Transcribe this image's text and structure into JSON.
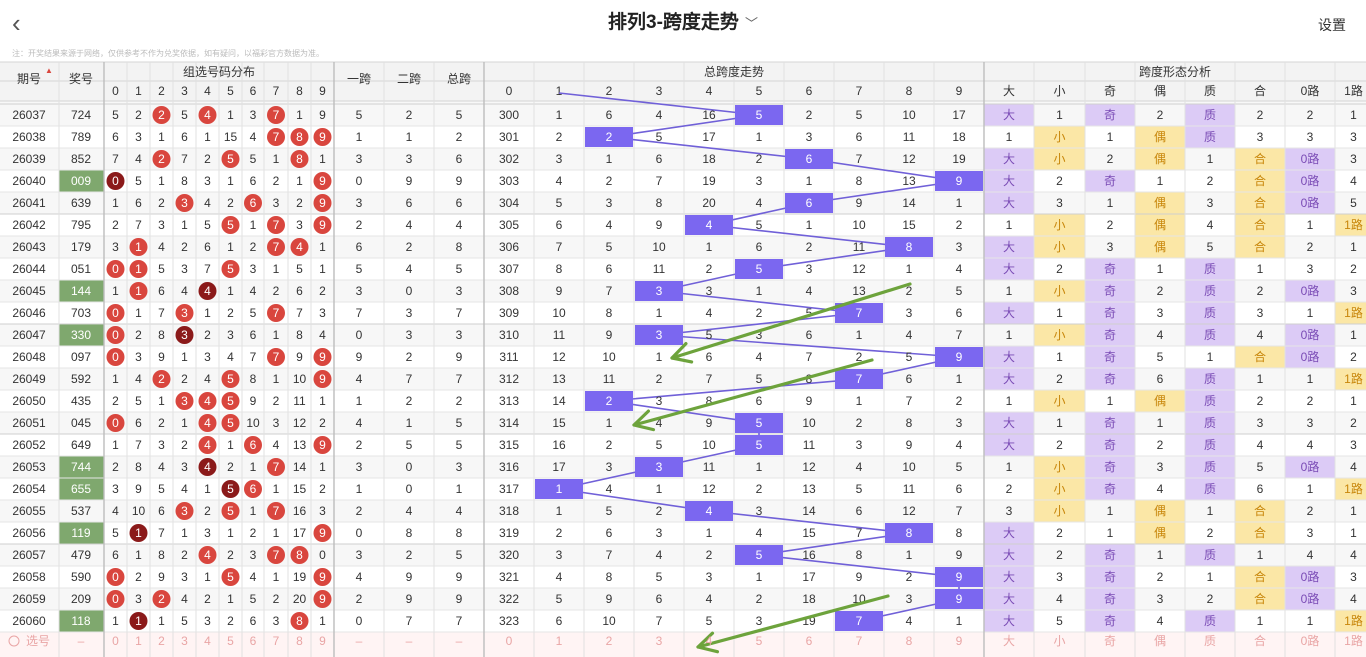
{
  "header": {
    "back_icon": "‹",
    "title": "排列3-跨度走势",
    "dropdown_icon": "chevron-down",
    "settings": "设置"
  },
  "note": "注：开奖结果来源于网络，仅供参考不作为兑奖依据，如有疑问，以福彩官方数据为准。",
  "colors": {
    "red": "#d9463e",
    "darkred": "#8b1a1a",
    "purple": "#7b67f0",
    "lilac": "#dccbf6",
    "yellow": "#fbe7a6",
    "green_award": "#7fa86e",
    "arrow": "#6da33c",
    "line": "#7060d8"
  },
  "columns": {
    "issue": "期号",
    "award": "奖号",
    "group_dist": "组选号码分布",
    "digits": [
      "0",
      "1",
      "2",
      "3",
      "4",
      "5",
      "6",
      "7",
      "8",
      "9"
    ],
    "span1": "一跨",
    "span2": "二跨",
    "total_span": "总跨",
    "total_trend": "总跨度走势",
    "trend_digits": [
      "0",
      "1",
      "2",
      "3",
      "4",
      "5",
      "6",
      "7",
      "8",
      "9"
    ],
    "shape": "跨度形态分析",
    "shape_cols": [
      "大",
      "小",
      "奇",
      "偶",
      "质",
      "合",
      "0路",
      "1路"
    ],
    "sort_icon": "▲"
  },
  "rows": [
    {
      "issue": "26037",
      "award": "724",
      "green": false,
      "dist": [
        5,
        2,
        "R2",
        5,
        "R4",
        1,
        3,
        "R7",
        1,
        9
      ],
      "s1": "5",
      "s2": "2",
      "ts": "5",
      "t": [
        300,
        1,
        6,
        4,
        16,
        "P5",
        2,
        5,
        10,
        17
      ],
      "sh": [
        "大",
        "1",
        "奇",
        "2",
        "质",
        "2",
        "2",
        "1"
      ]
    },
    {
      "issue": "26038",
      "award": "789",
      "green": false,
      "dist": [
        6,
        3,
        1,
        6,
        1,
        15,
        4,
        "R7",
        "R8",
        "R9"
      ],
      "s1": "1",
      "s2": "1",
      "ts": "2",
      "t": [
        301,
        2,
        "P2",
        5,
        17,
        1,
        3,
        6,
        11,
        18
      ],
      "sh": [
        "1",
        "小",
        "1",
        "偶",
        "质",
        "3",
        "3",
        "3"
      ]
    },
    {
      "issue": "26039",
      "award": "852",
      "green": false,
      "dist": [
        7,
        4,
        "R2",
        7,
        2,
        "R5",
        5,
        1,
        "R8",
        1
      ],
      "s1": "3",
      "s2": "3",
      "ts": "6",
      "t": [
        302,
        3,
        1,
        6,
        18,
        2,
        "P6",
        7,
        12,
        19
      ],
      "sh": [
        "大",
        "小",
        "2",
        "偶",
        "1",
        "合",
        "0路",
        "3"
      ]
    },
    {
      "issue": "26040",
      "award": "009",
      "green": true,
      "dist": [
        "D0",
        5,
        1,
        8,
        3,
        1,
        6,
        2,
        1,
        "R9"
      ],
      "s1": "0",
      "s2": "9",
      "ts": "9",
      "t": [
        303,
        4,
        2,
        7,
        19,
        3,
        1,
        8,
        13,
        "P9"
      ],
      "sh": [
        "大",
        "2",
        "奇",
        "1",
        "2",
        "合",
        "0路",
        "4"
      ]
    },
    {
      "issue": "26041",
      "award": "639",
      "green": false,
      "dist": [
        1,
        6,
        2,
        "R3",
        4,
        2,
        "R6",
        3,
        2,
        "R9"
      ],
      "s1": "3",
      "s2": "6",
      "ts": "6",
      "t": [
        304,
        5,
        3,
        8,
        20,
        4,
        "P6",
        9,
        14,
        1
      ],
      "sh": [
        "大",
        "3",
        "1",
        "偶",
        "3",
        "合",
        "0路",
        "5"
      ]
    },
    {
      "issue": "26042",
      "award": "795",
      "green": false,
      "dist": [
        2,
        7,
        3,
        1,
        5,
        "R5",
        1,
        "R7",
        3,
        "R9"
      ],
      "s1": "2",
      "s2": "4",
      "ts": "4",
      "t": [
        305,
        6,
        4,
        9,
        "P4",
        5,
        1,
        10,
        15,
        2
      ],
      "sh": [
        "1",
        "小",
        "2",
        "偶",
        "4",
        "合",
        "1",
        "1路"
      ]
    },
    {
      "issue": "26043",
      "award": "179",
      "green": false,
      "dist": [
        3,
        "R1",
        4,
        2,
        6,
        1,
        2,
        "R7",
        "R4",
        1
      ],
      "s1": "6",
      "s2": "2",
      "ts": "8",
      "t": [
        306,
        7,
        5,
        10,
        1,
        6,
        2,
        11,
        "P8",
        3
      ],
      "sh": [
        "大",
        "小",
        "3",
        "偶",
        "5",
        "合",
        "2",
        "1"
      ]
    },
    {
      "issue": "26044",
      "award": "051",
      "green": false,
      "dist": [
        "R0",
        "R1",
        5,
        3,
        7,
        "R5",
        3,
        1,
        5,
        1
      ],
      "s1": "5",
      "s2": "4",
      "ts": "5",
      "t": [
        307,
        8,
        6,
        11,
        2,
        "P5",
        3,
        12,
        1,
        4
      ],
      "sh": [
        "大",
        "2",
        "奇",
        "1",
        "质",
        "1",
        "3",
        "2"
      ]
    },
    {
      "issue": "26045",
      "award": "144",
      "green": true,
      "dist": [
        1,
        "R1",
        6,
        4,
        "D4",
        1,
        4,
        2,
        6,
        2
      ],
      "s1": "3",
      "s2": "0",
      "ts": "3",
      "t": [
        308,
        9,
        7,
        "P3",
        3,
        1,
        4,
        13,
        2,
        5
      ],
      "sh": [
        "1",
        "小",
        "奇",
        "2",
        "质",
        "2",
        "0路",
        "3"
      ]
    },
    {
      "issue": "26046",
      "award": "703",
      "green": false,
      "dist": [
        "R0",
        1,
        7,
        "R3",
        1,
        2,
        5,
        "R7",
        7,
        3
      ],
      "s1": "7",
      "s2": "3",
      "ts": "7",
      "t": [
        309,
        10,
        8,
        1,
        4,
        2,
        5,
        "P7",
        3,
        6
      ],
      "sh": [
        "大",
        "1",
        "奇",
        "3",
        "质",
        "3",
        "1",
        "1路"
      ]
    },
    {
      "issue": "26047",
      "award": "330",
      "green": true,
      "dist": [
        "R0",
        2,
        8,
        "D3",
        2,
        3,
        6,
        1,
        8,
        4
      ],
      "s1": "0",
      "s2": "3",
      "ts": "3",
      "t": [
        310,
        11,
        9,
        "P3",
        5,
        3,
        6,
        1,
        4,
        7
      ],
      "sh": [
        "1",
        "小",
        "奇",
        "4",
        "质",
        "4",
        "0路",
        "1"
      ]
    },
    {
      "issue": "26048",
      "award": "097",
      "green": false,
      "dist": [
        "R0",
        3,
        9,
        1,
        3,
        4,
        7,
        "R7",
        9,
        "R9"
      ],
      "s1": "9",
      "s2": "2",
      "ts": "9",
      "t": [
        311,
        12,
        10,
        1,
        6,
        4,
        7,
        2,
        5,
        "P9"
      ],
      "sh": [
        "大",
        "1",
        "奇",
        "5",
        "1",
        "合",
        "0路",
        "2"
      ]
    },
    {
      "issue": "26049",
      "award": "592",
      "green": false,
      "dist": [
        1,
        4,
        "R2",
        2,
        4,
        "R5",
        8,
        1,
        10,
        "R9"
      ],
      "s1": "4",
      "s2": "7",
      "ts": "7",
      "t": [
        312,
        13,
        11,
        2,
        7,
        5,
        8,
        "P7",
        6,
        1
      ],
      "sh": [
        "大",
        "2",
        "奇",
        "6",
        "质",
        "1",
        "1",
        "1路"
      ]
    },
    {
      "issue": "26050",
      "award": "435",
      "green": false,
      "dist": [
        2,
        5,
        1,
        "R3",
        "R4",
        "R5",
        9,
        2,
        11,
        1
      ],
      "s1": "1",
      "s2": "2",
      "ts": "2",
      "t": [
        313,
        14,
        "P2",
        3,
        8,
        6,
        9,
        1,
        7,
        2
      ],
      "sh": [
        "1",
        "小",
        "1",
        "偶",
        "质",
        "2",
        "2",
        "1"
      ]
    },
    {
      "issue": "26051",
      "award": "045",
      "green": false,
      "dist": [
        "R0",
        6,
        2,
        1,
        "R4",
        "R5",
        10,
        3,
        12,
        2
      ],
      "s1": "4",
      "s2": "1",
      "ts": "5",
      "t": [
        314,
        15,
        1,
        4,
        9,
        "P5",
        10,
        2,
        8,
        3
      ],
      "sh": [
        "大",
        "1",
        "奇",
        "1",
        "质",
        "3",
        "3",
        "2"
      ]
    },
    {
      "issue": "26052",
      "award": "649",
      "green": false,
      "dist": [
        1,
        7,
        3,
        2,
        "R4",
        1,
        "R6",
        4,
        13,
        "R9"
      ],
      "s1": "2",
      "s2": "5",
      "ts": "5",
      "t": [
        315,
        16,
        2,
        5,
        10,
        "P5",
        11,
        3,
        9,
        4
      ],
      "sh": [
        "大",
        "2",
        "奇",
        "2",
        "质",
        "4",
        "4",
        "3"
      ]
    },
    {
      "issue": "26053",
      "award": "744",
      "green": true,
      "dist": [
        2,
        8,
        4,
        3,
        "D4",
        2,
        1,
        "R7",
        14,
        1
      ],
      "s1": "3",
      "s2": "0",
      "ts": "3",
      "t": [
        316,
        17,
        3,
        "P3",
        11,
        1,
        12,
        4,
        10,
        5
      ],
      "sh": [
        "1",
        "小",
        "奇",
        "3",
        "质",
        "5",
        "0路",
        "4"
      ]
    },
    {
      "issue": "26054",
      "award": "655",
      "green": true,
      "dist": [
        3,
        9,
        5,
        4,
        1,
        "D5",
        "R6",
        1,
        15,
        2
      ],
      "s1": "1",
      "s2": "0",
      "ts": "1",
      "t": [
        317,
        "P1",
        4,
        1,
        12,
        2,
        13,
        5,
        11,
        6
      ],
      "sh": [
        "2",
        "小",
        "奇",
        "4",
        "质",
        "6",
        "1",
        "1路"
      ]
    },
    {
      "issue": "26055",
      "award": "537",
      "green": false,
      "dist": [
        4,
        10,
        6,
        "R3",
        2,
        "R5",
        1,
        "R7",
        16,
        3
      ],
      "s1": "2",
      "s2": "4",
      "ts": "4",
      "t": [
        318,
        1,
        5,
        2,
        "P4",
        3,
        14,
        6,
        12,
        7
      ],
      "sh": [
        "3",
        "小",
        "1",
        "偶",
        "1",
        "合",
        "2",
        "1"
      ]
    },
    {
      "issue": "26056",
      "award": "119",
      "green": true,
      "dist": [
        5,
        "D1",
        7,
        1,
        3,
        1,
        2,
        1,
        17,
        "R9"
      ],
      "s1": "0",
      "s2": "8",
      "ts": "8",
      "t": [
        319,
        2,
        6,
        3,
        1,
        4,
        15,
        7,
        "P8",
        8
      ],
      "sh": [
        "大",
        "2",
        "1",
        "偶",
        "2",
        "合",
        "3",
        "1"
      ]
    },
    {
      "issue": "26057",
      "award": "479",
      "green": false,
      "dist": [
        6,
        1,
        8,
        2,
        "R4",
        2,
        3,
        "R7",
        "R8",
        0
      ],
      "s1": "3",
      "s2": "2",
      "ts": "5",
      "t": [
        320,
        3,
        7,
        4,
        2,
        "P5",
        16,
        8,
        1,
        9
      ],
      "sh": [
        "大",
        "2",
        "奇",
        "1",
        "质",
        "1",
        "4",
        "4"
      ]
    },
    {
      "issue": "26058",
      "award": "590",
      "green": false,
      "dist": [
        "R0",
        2,
        9,
        3,
        1,
        "R5",
        4,
        1,
        19,
        "R9"
      ],
      "s1": "4",
      "s2": "9",
      "ts": "9",
      "t": [
        321,
        4,
        8,
        5,
        3,
        1,
        17,
        9,
        2,
        "P9"
      ],
      "sh": [
        "大",
        "3",
        "奇",
        "2",
        "1",
        "合",
        "0路",
        "3"
      ]
    },
    {
      "issue": "26059",
      "award": "209",
      "green": false,
      "dist": [
        "R0",
        3,
        "R2",
        4,
        2,
        1,
        5,
        2,
        20,
        "R9"
      ],
      "s1": "2",
      "s2": "9",
      "ts": "9",
      "t": [
        322,
        5,
        9,
        6,
        4,
        2,
        18,
        10,
        3,
        "P9"
      ],
      "sh": [
        "大",
        "4",
        "奇",
        "3",
        "2",
        "合",
        "0路",
        "4"
      ]
    },
    {
      "issue": "26060",
      "award": "118",
      "green": true,
      "dist": [
        1,
        "D1",
        1,
        5,
        3,
        2,
        6,
        3,
        "R8",
        1
      ],
      "s1": "0",
      "s2": "7",
      "ts": "7",
      "t": [
        323,
        6,
        10,
        7,
        5,
        3,
        19,
        "P7",
        4,
        1
      ],
      "sh": [
        "大",
        "5",
        "奇",
        "4",
        "质",
        "1",
        "1",
        "1路"
      ]
    }
  ],
  "select_row": {
    "label": "选号",
    "dash": "–",
    "digits": [
      "0",
      "1",
      "2",
      "3",
      "4",
      "5",
      "6",
      "7",
      "8",
      "9"
    ],
    "trend": [
      "0",
      "1",
      "2",
      "3",
      "4",
      "5",
      "6",
      "7",
      "8",
      "9"
    ],
    "shape": [
      "大",
      "小",
      "奇",
      "偶",
      "质",
      "合",
      "0路",
      "1路"
    ]
  }
}
